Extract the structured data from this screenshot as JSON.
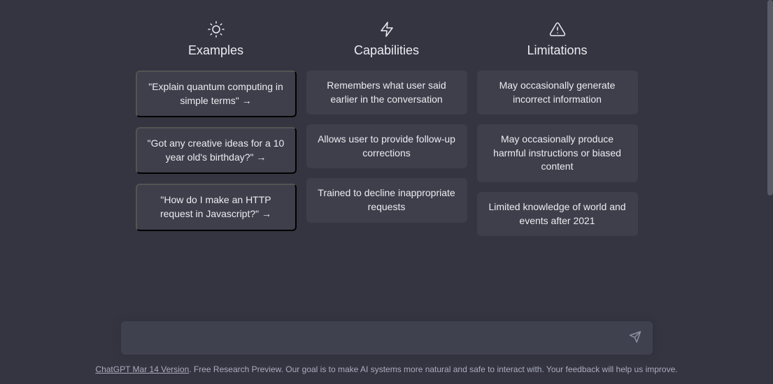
{
  "columns": [
    {
      "title": "Examples",
      "cards": [
        "\"Explain quantum computing in simple terms\" →",
        "\"Got any creative ideas for a 10 year old's birthday?\" →",
        "\"How do I make an HTTP request in Javascript?\" →"
      ]
    },
    {
      "title": "Capabilities",
      "cards": [
        "Remembers what user said earlier in the conversation",
        "Allows user to provide follow-up corrections",
        "Trained to decline inappropriate requests"
      ]
    },
    {
      "title": "Limitations",
      "cards": [
        "May occasionally generate incorrect information",
        "May occasionally produce harmful instructions or biased content",
        "Limited knowledge of world and events after 2021"
      ]
    }
  ],
  "footer": {
    "version_link": "ChatGPT Mar 14 Version",
    "text": ". Free Research Preview. Our goal is to make AI systems more natural and safe to interact with. Your feedback will help us improve."
  }
}
